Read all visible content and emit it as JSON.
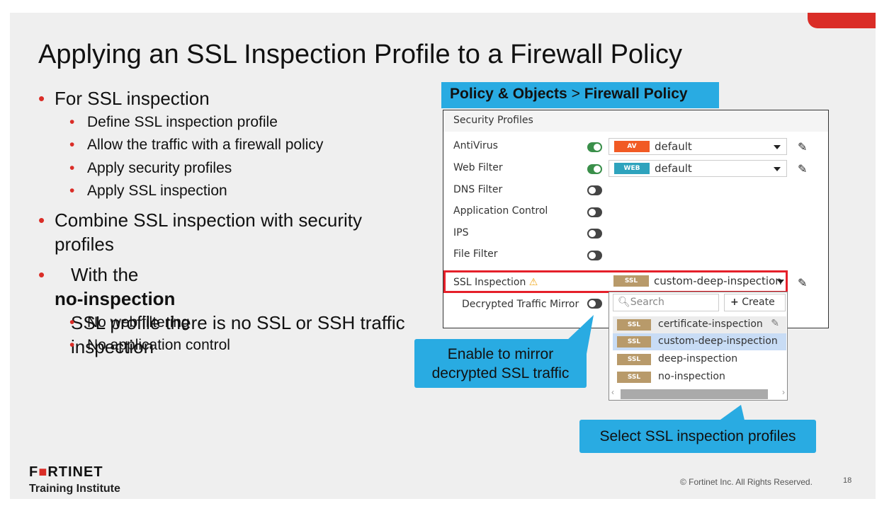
{
  "title": "Applying an SSL Inspection Profile to a Firewall Policy",
  "bullets": [
    {
      "text": "For SSL inspection",
      "sub": [
        "Define SSL inspection profile",
        "Allow the traffic with a firewall policy",
        "Apply security profiles",
        "Apply SSL inspection"
      ]
    },
    {
      "text": "Combine SSL inspection with security profiles"
    },
    {
      "text_pre": "With the ",
      "text_bold": "no-inspection",
      "text_post": " SSL profile there is no SSL or SSH traffic inspection",
      "sub": [
        "No web filtering",
        "No application control"
      ]
    }
  ],
  "breadcrumb": {
    "part1": "Policy & Objects",
    "sep": ">",
    "part2": "Firewall Policy"
  },
  "panel": {
    "header": "Security Profiles",
    "rows": [
      {
        "label": "AntiVirus",
        "enabled": true,
        "tag": "AV",
        "value": "default"
      },
      {
        "label": "Web Filter",
        "enabled": true,
        "tag": "WEB",
        "value": "default"
      },
      {
        "label": "DNS Filter",
        "enabled": false
      },
      {
        "label": "Application Control",
        "enabled": false
      },
      {
        "label": "IPS",
        "enabled": false
      },
      {
        "label": "File Filter",
        "enabled": false
      }
    ],
    "ssl": {
      "label": "SSL Inspection",
      "tag": "SSL",
      "value": "custom-deep-inspection"
    },
    "mirror": {
      "label": "Decrypted Traffic Mirror",
      "enabled": false
    },
    "dropdown": {
      "search_placeholder": "Search",
      "create_label": "Create",
      "options": [
        "certificate-inspection",
        "custom-deep-inspection",
        "deep-inspection",
        "no-inspection"
      ],
      "option_tag": "SSL",
      "selected": "custom-deep-inspection"
    }
  },
  "callouts": {
    "mirror": "Enable to mirror decrypted SSL traffic",
    "select": "Select SSL inspection profiles"
  },
  "footer": {
    "brand": "FORTINET",
    "sub": "Training Institute",
    "copyright": "© Fortinet Inc. All Rights Reserved.",
    "page": "18"
  },
  "colors": {
    "accent_red": "#da2d27",
    "callout_blue": "#29abe2",
    "av": "#f15a24",
    "web": "#2ea3bd",
    "ssl": "#b89a6a"
  }
}
